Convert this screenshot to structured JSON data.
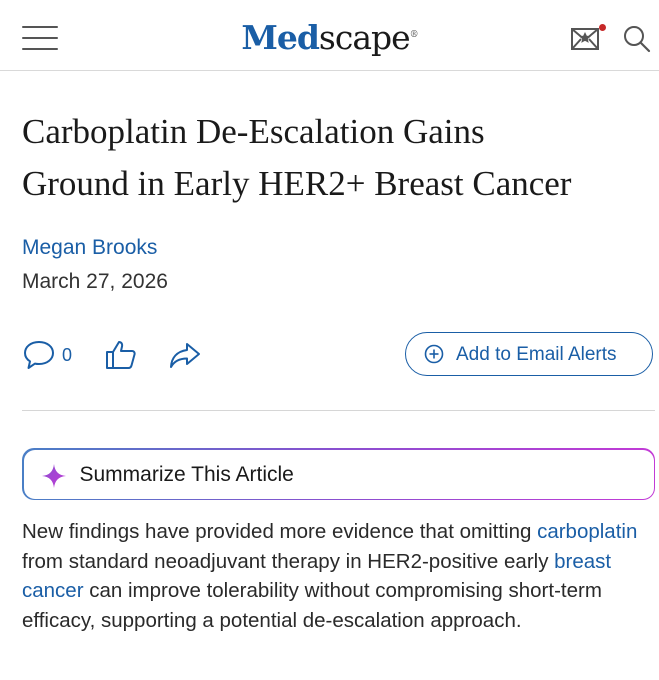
{
  "header": {
    "logo_part1": "Med",
    "logo_part2": "scape",
    "logo_mark": "®",
    "icons": [
      "menu-icon",
      "mail-star-icon",
      "search-icon"
    ],
    "notification_dot_color": "#c62828"
  },
  "article": {
    "title_line1": "Carboplatin De-Escalation Gains",
    "title_line2": "Ground in Early HER2+ Breast Cancer",
    "author": "Megan Brooks",
    "date": "March 27, 2026",
    "comment_count": "0",
    "alert_button_label": "Add to Email Alerts",
    "summarize_label": "Summarize This Article",
    "body": {
      "part1": "New findings have provided more evidence that omitting ",
      "link1": "carboplatin",
      "part2": " from standard neoadjuvant therapy in HER2-positive early ",
      "link2": "breast cancer",
      "part3": " can improve tolerability without compromising short-term efficacy, supporting a potential de-escalation approach."
    }
  },
  "colors": {
    "brand_blue": "#1a5ea6",
    "text": "#222222",
    "gradient": [
      "#4a7fc6",
      "#8a4fd0",
      "#c23ad6"
    ]
  }
}
